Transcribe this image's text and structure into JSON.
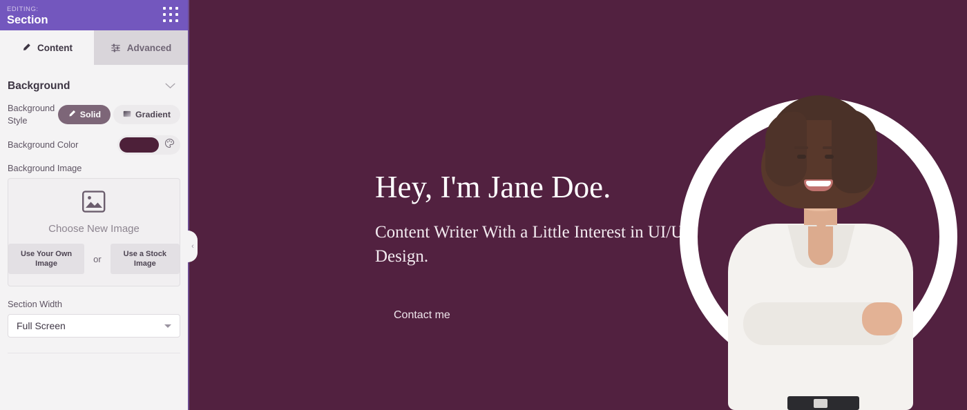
{
  "sidebar": {
    "header": {
      "editing_label": "EDITING:",
      "title": "Section",
      "grid_icon": "app-grid-icon"
    },
    "tabs": [
      {
        "label": "Content",
        "icon": "pencil-icon",
        "active": true
      },
      {
        "label": "Advanced",
        "icon": "sliders-icon",
        "active": false
      }
    ],
    "background_section": {
      "title": "Background",
      "collapse_icon": "chevron-down-icon",
      "style_field": {
        "label": "Background Style",
        "options": [
          {
            "label": "Solid",
            "icon": "pen-icon",
            "selected": true
          },
          {
            "label": "Gradient",
            "icon": "gradient-icon",
            "selected": false
          }
        ]
      },
      "color_field": {
        "label": "Background Color",
        "value": "#4d2039",
        "picker_icon": "palette-icon"
      },
      "image_field": {
        "label": "Background Image",
        "dropzone_icon": "image-placeholder-icon",
        "dropzone_title": "Choose New Image",
        "own_image_button": "Use Your Own Image",
        "separator": "or",
        "stock_image_button": "Use a Stock Image"
      },
      "width_field": {
        "label": "Section Width",
        "value": "Full Screen",
        "caret_icon": "caret-down-icon"
      }
    },
    "collapse_handle": {
      "icon": "chevron-left-icon",
      "glyph": "‹"
    }
  },
  "canvas": {
    "background_color": "#522140",
    "hero": {
      "title": "Hey, I'm Jane Doe.",
      "subtitle": "Content Writer With a Little Interest in UI/UX Design.",
      "cta": "Contact me"
    },
    "portrait": {
      "alt": "smiling-woman-arms-crossed-photo",
      "ring_color": "#ffffff"
    }
  },
  "colors": {
    "header_purple": "#7357be",
    "panel_background": "#f4f3f4",
    "inactive_tab": "#d9d5da",
    "accent_plum": "#522140",
    "swatch_plum": "#4d2039"
  }
}
